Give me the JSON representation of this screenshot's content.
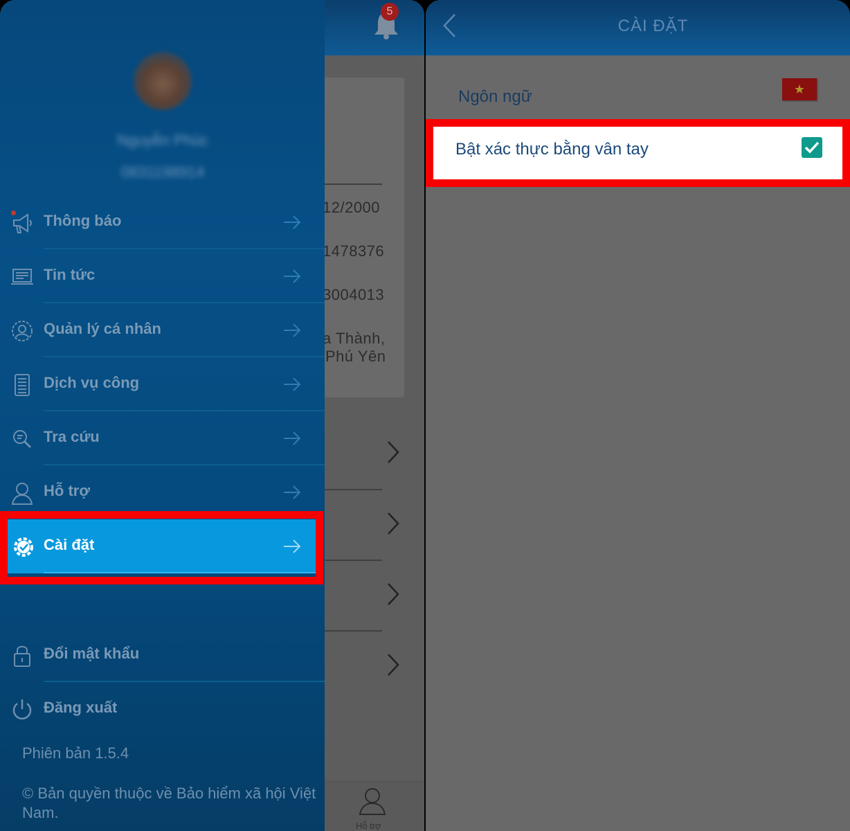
{
  "left_screen": {
    "notification_badge": "5",
    "background_values": {
      "row1": "12/2000",
      "row2": "1478376",
      "row3": "3004013",
      "row4_line1": "a Thành,",
      "row4_line2": "Phú Yên"
    },
    "bottom_nav_label": "Hỗ trợ",
    "drawer": {
      "user_name": "Nguyễn Phúc",
      "user_id": "0831198914",
      "menu": [
        {
          "label": "Thông báo",
          "icon": "megaphone-icon"
        },
        {
          "label": "Tin tức",
          "icon": "newspaper-icon"
        },
        {
          "label": "Quản lý cá nhân",
          "icon": "profile-icon"
        },
        {
          "label": "Dịch vụ công",
          "icon": "calculator-icon"
        },
        {
          "label": "Tra cứu",
          "icon": "search-doc-icon"
        },
        {
          "label": "Hỗ trợ",
          "icon": "user-support-icon"
        },
        {
          "label": "Cài đặt",
          "icon": "gear-icon"
        }
      ],
      "account": [
        {
          "label": "Đổi mật khẩu",
          "icon": "lock-icon"
        },
        {
          "label": "Đăng xuất",
          "icon": "power-icon"
        }
      ],
      "version": "Phiên bản 1.5.4",
      "copyright": "© Bản quyền thuộc về  Bảo hiểm xã hội Việt Nam."
    },
    "colors": {
      "drawer": "#065087",
      "active": "#0898de",
      "highlight": "#f80000"
    }
  },
  "right_screen": {
    "title": "CÀI ĐẶT",
    "language_label": "Ngôn ngữ",
    "fingerprint_label": "Bật xác thực bằng vân tay",
    "fingerprint_enabled": true,
    "flag_icon": "vietnam-flag-icon",
    "colors": {
      "checkbox": "#0e9b8c",
      "highlight": "#f80000"
    }
  }
}
